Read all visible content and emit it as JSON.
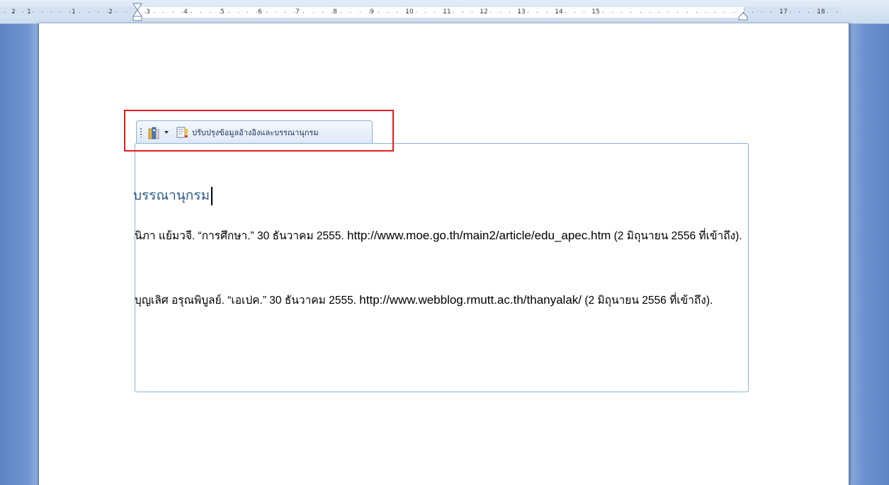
{
  "ruler": {
    "labels": [
      "2",
      "1",
      "1",
      "2",
      "3",
      "4",
      "5",
      "6",
      "7",
      "8",
      "9",
      "10",
      "11",
      "12",
      "13",
      "14",
      "15",
      "17",
      "18"
    ]
  },
  "content_control": {
    "tab_label": "ปรับปรุงข้อมูลอ้างอิงและบรรณานุกรม",
    "heading": "บรรณานุกรม",
    "entries": [
      {
        "before_url": "นิภา แย้มวจี. “การศึกษา.” 30 ธันวาคม 2555. ",
        "url": "http://www.moe.go.th/main2/article/edu_apec.htm",
        "after_url": " (2 มิถุนายน 2556 ที่เข้าถึง)."
      },
      {
        "before_url": "บุญเลิศ อรุณพิบูลย์. “เอเปค.” 30 ธันวาคม 2555. ",
        "url": "http://www.webblog.rmutt.ac.th/thanyalak/",
        "after_url": " (2 มิถุนายน 2556 ที่เข้าถึง)."
      }
    ]
  },
  "colors": {
    "workspace_blue": "#8faedd",
    "highlight_box": "#e51b1b",
    "heading_text": "#2e5c8a",
    "control_border": "#8fb0d7"
  },
  "icons": {
    "grip": "grip-dots-icon",
    "bibliography_menu": "bibliography-books-icon",
    "update_citations": "update-citations-icon"
  }
}
